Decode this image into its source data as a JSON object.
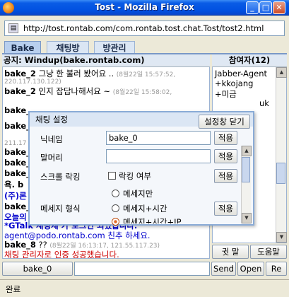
{
  "window": {
    "title": "Tost - Mozilla Firefox",
    "minimize": "_",
    "maximize": "□",
    "close": "✕"
  },
  "address_bar": {
    "url": "http://tost.rontab.com/com.rontab.tost.chat.Tost/tost2.html"
  },
  "tabs": [
    {
      "label": "Bake"
    },
    {
      "label": "채팅방"
    },
    {
      "label": "방관리"
    }
  ],
  "notice": "공지: Windup(bake.rontab.com)",
  "chat": {
    "lines": [
      {
        "nick": "bake_2",
        "text": "그냥 한 불러 봤어요 ..",
        "meta": "(8월22일 15:57:52,",
        "ip": "220.117.130.122)"
      },
      {
        "nick": "bake_2",
        "text": "인지 잡답나해서요 ~",
        "meta": "(8월22일 15:58:02,",
        "ip": ""
      }
    ],
    "partial_bake_1": "bake_",
    "partial_bake_2": "bake_",
    "partial_ip_1": "211.17",
    "partial_bake_3": "bake_",
    "partial_nicks": [
      "bake_",
      "bake_"
    ],
    "partial_word": "욕. b",
    "partial_company": "(주)론",
    "partial_bake_4": "bake_",
    "partial_today": "오늘의",
    "gtalk_line": "*GTalk 채팅체 가 로그인 되었습니다.",
    "podo_line": "agent@podo.rontab.com 친추 하세요.",
    "last_line": {
      "nick": "bake_8",
      "text": "??",
      "meta": "(8월22일 16:13:17, 121.55.117.23)"
    },
    "admin_line": "채팅 관리자로 인증 성공했습니다."
  },
  "participants": {
    "header": "참여자(12)",
    "items": [
      "Jabber-Agent",
      "+kkojang",
      "+미금"
    ],
    "partial_uk": "uk"
  },
  "dialog": {
    "title": "채팅 설정",
    "close_button": "설정창 닫기",
    "nickname_label": "닉네임",
    "nickname_value": "bake_0",
    "prefix_label": "말머리",
    "prefix_value": "",
    "apply": "적용",
    "scroll_lock_label": "스크롤 락킹",
    "scroll_lock_option": "락킹 여부",
    "message_format_label": "메세지 형식",
    "format_options": [
      "메세지만",
      "메세지+시간",
      "메세지+시간+IP"
    ]
  },
  "side_buttons": {
    "whisper": "귓 말",
    "help": "도움말"
  },
  "input_row": {
    "nick_button": "bake_0",
    "send": "Send",
    "open": "Open",
    "re": "Re"
  },
  "status": {
    "text": "완료"
  }
}
